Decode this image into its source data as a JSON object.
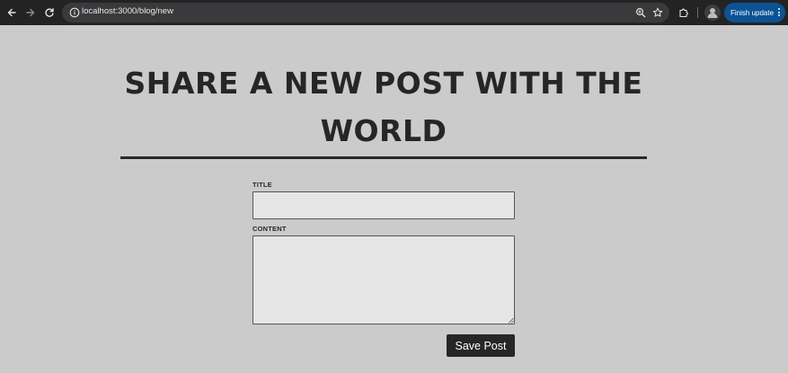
{
  "browser": {
    "url": "localhost:3000/blog/new",
    "update_button_label": "Finish update"
  },
  "page": {
    "heading": "SHARE A NEW POST WITH THE WORLD",
    "form": {
      "title_label": "TITLE",
      "title_value": "",
      "content_label": "CONTENT",
      "content_value": "",
      "submit_label": "Save Post"
    }
  },
  "icons": {
    "back": "arrow-left-icon",
    "forward": "arrow-right-icon",
    "reload": "reload-icon",
    "site_info": "info-icon",
    "zoom": "zoom-icon",
    "bookmark": "star-icon",
    "extensions": "puzzle-icon",
    "profile": "avatar",
    "menu": "kebab-menu-icon"
  },
  "colors": {
    "page_background": "#cbcbcb",
    "text": "#262626",
    "button_background": "#262626",
    "button_text": "#ffffff",
    "update_button": "#0b5394"
  }
}
